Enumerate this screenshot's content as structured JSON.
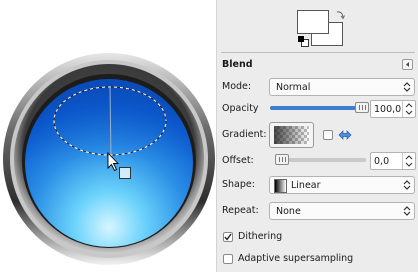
{
  "tool_options": {
    "title": "Blend",
    "mode": {
      "label": "Mode:",
      "value": "Normal"
    },
    "opacity": {
      "label": "Opacity",
      "value": "100,0",
      "fraction": 1.0
    },
    "gradient": {
      "label": "Gradient:"
    },
    "offset": {
      "label": "Offset:",
      "value": "0,0",
      "fraction": 0.0
    },
    "shape": {
      "label": "Shape:",
      "value": "Linear"
    },
    "repeat": {
      "label": "Repeat:",
      "value": "None"
    },
    "dithering": {
      "label": "Dithering",
      "checked": true
    },
    "adaptive_supersampling": {
      "label": "Adaptive supersampling",
      "checked": false
    }
  },
  "colors": {
    "accent": "#3c7fd0",
    "ring_outer": "#a9a9a9",
    "ring_inner": "#2a2a2a",
    "sphere_top": "#0b57c9",
    "sphere_bottom": "#9fe6ff",
    "panel_bg": "#ececec"
  }
}
